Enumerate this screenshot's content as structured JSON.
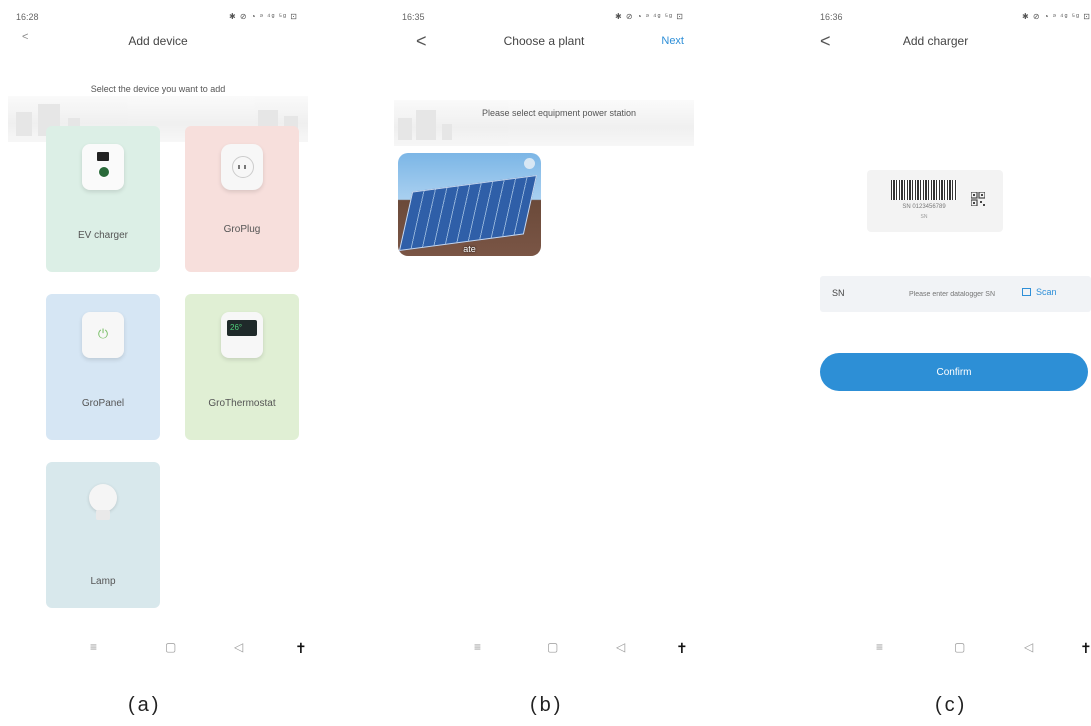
{
  "screens": {
    "a": {
      "time": "16:28",
      "status_icons": "✱ ⊘ ◔ ᵊ ⁴ᵍ ⁵ᵍ ⊡",
      "title": "Add device",
      "subtitle": "Select the device you want to add",
      "devices": [
        "EV charger",
        "GroPlug",
        "GroPanel",
        "GroThermostat",
        "Lamp"
      ],
      "thermostat_display": "26°",
      "caption": "(a)"
    },
    "b": {
      "time": "16:35",
      "status_icons": "✱ ⊘ ◔ ᵊ ⁴ᵍ ⁵ᵍ ⊡",
      "title": "Choose a plant",
      "next": "Next",
      "subtitle": "Please select equipment power station",
      "plant_name": "ate",
      "caption": "(b)"
    },
    "c": {
      "time": "16:36",
      "status_icons": "✱ ⊘ ◔ ᵊ ⁴ᵍ ⁵ᵍ ⊡",
      "title": "Add charger",
      "barcode_sn": "SN 0123456789",
      "barcode_sub": "SN",
      "sn_label": "SN",
      "sn_placeholder": "Please enter datalogger SN",
      "scan_label": "Scan",
      "confirm": "Confirm",
      "caption": "(c)"
    }
  },
  "navbar": {
    "menu": "≡",
    "home": "▢",
    "back": "◁",
    "accessibility": "✝"
  },
  "icons": {
    "back": "chevron-left-icon",
    "qr": "qr-code-icon",
    "scan": "scan-icon"
  },
  "colors": {
    "accent": "#2e8fd8",
    "ev_tile": "#dcefe6",
    "plug_tile": "#f7dfdc",
    "panel_tile": "#d6e6f4",
    "thermo_tile": "#e0efd4",
    "lamp_tile": "#d8e8ec"
  }
}
